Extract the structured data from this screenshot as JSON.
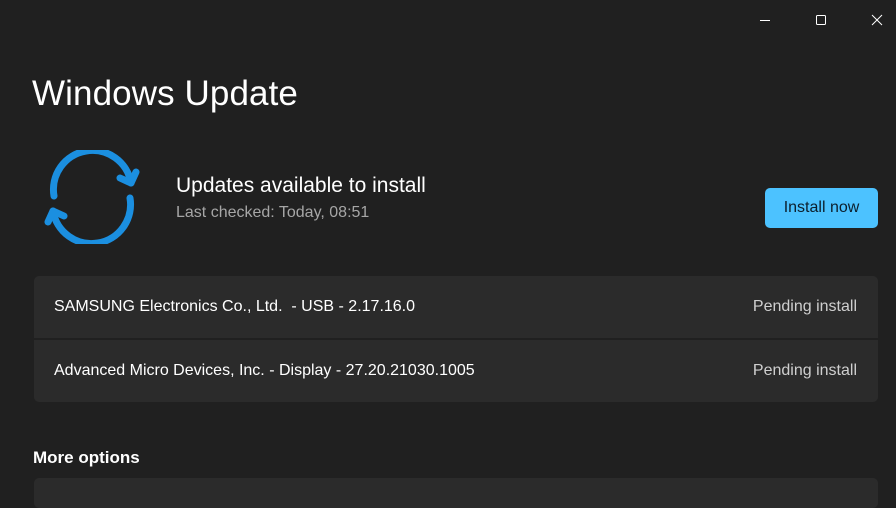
{
  "window": {
    "controls": {
      "minimize_icon": "minimize-icon",
      "maximize_icon": "maximize-icon",
      "close_icon": "close-icon"
    }
  },
  "page": {
    "title": "Windows Update"
  },
  "status": {
    "icon": "sync-icon",
    "heading": "Updates available to install",
    "last_checked": "Last checked: Today, 08:51"
  },
  "actions": {
    "install_label": "Install now"
  },
  "updates": [
    {
      "name": "SAMSUNG Electronics Co., Ltd.  - USB - 2.17.16.0",
      "status": "Pending install"
    },
    {
      "name": "Advanced Micro Devices, Inc. - Display - 27.20.21030.1005",
      "status": "Pending install"
    }
  ],
  "more_options": {
    "heading": "More options"
  },
  "colors": {
    "background": "#202020",
    "card": "#2b2b2b",
    "accent": "#4cc2ff",
    "icon_blue": "#1b8fe0",
    "secondary_text": "#a6a6a6"
  }
}
